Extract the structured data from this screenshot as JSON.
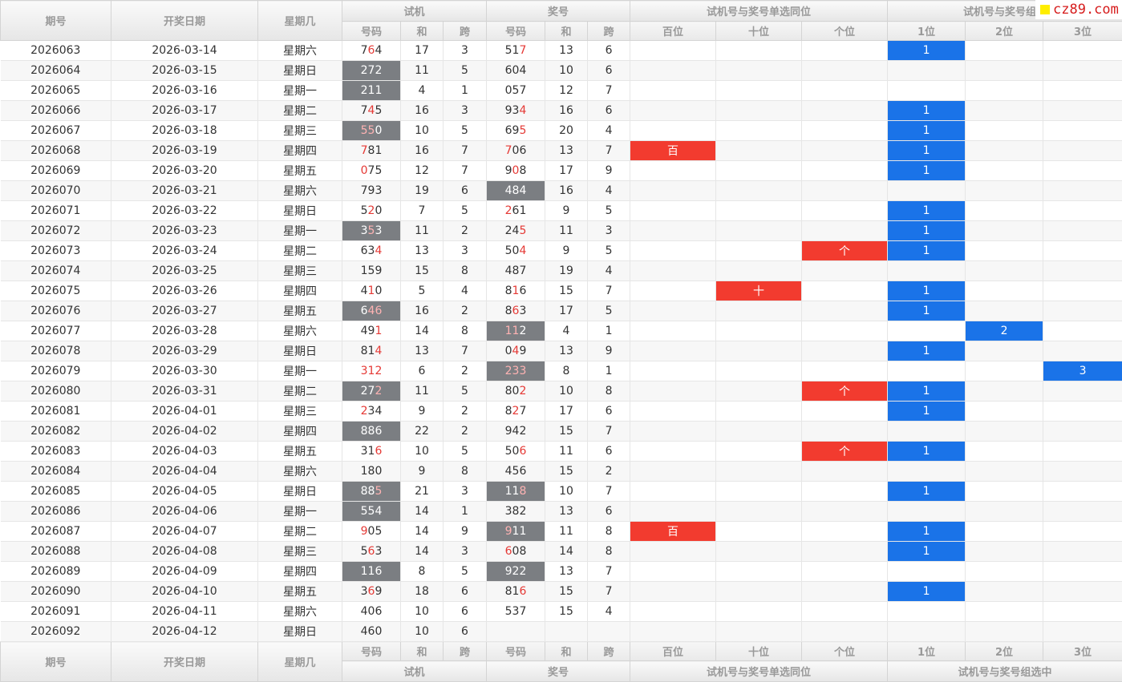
{
  "header": {
    "col_issue": "期号",
    "col_date": "开奖日期",
    "col_week": "星期几",
    "group_trial": "试机",
    "group_prize": "奖号",
    "group_same_pos": "试机号与奖号单选同位",
    "group_combo_top": "试机号与奖号组选",
    "group_combo_bottom": "试机号与奖号组选中",
    "sub_number": "号码",
    "sub_sum": "和",
    "sub_span": "跨",
    "sub_hundreds": "百位",
    "sub_tens": "十位",
    "sub_ones": "个位",
    "sub_1": "1位",
    "sub_2": "2位",
    "sub_3": "3位"
  },
  "watermark": {
    "text": "cz89.com"
  },
  "colors": {
    "gray_cell": "#7b7e82",
    "red_hit": "#f23b2f",
    "blue_hit": "#1a73e8",
    "red_digit": "#e53935"
  },
  "rows": [
    {
      "issue": "2026063",
      "date": "2026-03-14",
      "week": "星期六",
      "trial": "764",
      "trial_red": [
        1
      ],
      "trial_gray": false,
      "tsum": "17",
      "tspan": "3",
      "prize": "517",
      "prize_red": [
        2
      ],
      "prize_gray": false,
      "psum": "13",
      "pspan": "6",
      "pos": "",
      "combo": "1"
    },
    {
      "issue": "2026064",
      "date": "2026-03-15",
      "week": "星期日",
      "trial": "272",
      "trial_red": [],
      "trial_gray": true,
      "tsum": "11",
      "tspan": "5",
      "prize": "604",
      "prize_red": [],
      "prize_gray": false,
      "psum": "10",
      "pspan": "6",
      "pos": "",
      "combo": ""
    },
    {
      "issue": "2026065",
      "date": "2026-03-16",
      "week": "星期一",
      "trial": "211",
      "trial_red": [],
      "trial_gray": true,
      "tsum": "4",
      "tspan": "1",
      "prize": "057",
      "prize_red": [],
      "prize_gray": false,
      "psum": "12",
      "pspan": "7",
      "pos": "",
      "combo": ""
    },
    {
      "issue": "2026066",
      "date": "2026-03-17",
      "week": "星期二",
      "trial": "745",
      "trial_red": [
        1
      ],
      "trial_gray": false,
      "tsum": "16",
      "tspan": "3",
      "prize": "934",
      "prize_red": [
        2
      ],
      "prize_gray": false,
      "psum": "16",
      "pspan": "6",
      "pos": "",
      "combo": "1"
    },
    {
      "issue": "2026067",
      "date": "2026-03-18",
      "week": "星期三",
      "trial": "550",
      "trial_red": [
        0,
        1
      ],
      "trial_gray": true,
      "tsum": "10",
      "tspan": "5",
      "prize": "695",
      "prize_red": [
        2
      ],
      "prize_gray": false,
      "psum": "20",
      "pspan": "4",
      "pos": "",
      "combo": "1"
    },
    {
      "issue": "2026068",
      "date": "2026-03-19",
      "week": "星期四",
      "trial": "781",
      "trial_red": [
        0
      ],
      "trial_gray": false,
      "tsum": "16",
      "tspan": "7",
      "prize": "706",
      "prize_red": [
        0
      ],
      "prize_gray": false,
      "psum": "13",
      "pspan": "7",
      "pos": "百",
      "combo": "1"
    },
    {
      "issue": "2026069",
      "date": "2026-03-20",
      "week": "星期五",
      "trial": "075",
      "trial_red": [
        0
      ],
      "trial_gray": false,
      "tsum": "12",
      "tspan": "7",
      "prize": "908",
      "prize_red": [
        1
      ],
      "prize_gray": false,
      "psum": "17",
      "pspan": "9",
      "pos": "",
      "combo": "1"
    },
    {
      "issue": "2026070",
      "date": "2026-03-21",
      "week": "星期六",
      "trial": "793",
      "trial_red": [],
      "trial_gray": false,
      "tsum": "19",
      "tspan": "6",
      "prize": "484",
      "prize_red": [],
      "prize_gray": true,
      "psum": "16",
      "pspan": "4",
      "pos": "",
      "combo": ""
    },
    {
      "issue": "2026071",
      "date": "2026-03-22",
      "week": "星期日",
      "trial": "520",
      "trial_red": [
        1
      ],
      "trial_gray": false,
      "tsum": "7",
      "tspan": "5",
      "prize": "261",
      "prize_red": [
        0
      ],
      "prize_gray": false,
      "psum": "9",
      "pspan": "5",
      "pos": "",
      "combo": "1"
    },
    {
      "issue": "2026072",
      "date": "2026-03-23",
      "week": "星期一",
      "trial": "353",
      "trial_red": [
        1
      ],
      "trial_gray": true,
      "tsum": "11",
      "tspan": "2",
      "prize": "245",
      "prize_red": [
        2
      ],
      "prize_gray": false,
      "psum": "11",
      "pspan": "3",
      "pos": "",
      "combo": "1"
    },
    {
      "issue": "2026073",
      "date": "2026-03-24",
      "week": "星期二",
      "trial": "634",
      "trial_red": [
        2
      ],
      "trial_gray": false,
      "tsum": "13",
      "tspan": "3",
      "prize": "504",
      "prize_red": [
        2
      ],
      "prize_gray": false,
      "psum": "9",
      "pspan": "5",
      "pos": "个",
      "combo": "1"
    },
    {
      "issue": "2026074",
      "date": "2026-03-25",
      "week": "星期三",
      "trial": "159",
      "trial_red": [],
      "trial_gray": false,
      "tsum": "15",
      "tspan": "8",
      "prize": "487",
      "prize_red": [],
      "prize_gray": false,
      "psum": "19",
      "pspan": "4",
      "pos": "",
      "combo": ""
    },
    {
      "issue": "2026075",
      "date": "2026-03-26",
      "week": "星期四",
      "trial": "410",
      "trial_red": [
        1
      ],
      "trial_gray": false,
      "tsum": "5",
      "tspan": "4",
      "prize": "816",
      "prize_red": [
        1
      ],
      "prize_gray": false,
      "psum": "15",
      "pspan": "7",
      "pos": "十",
      "combo": "1"
    },
    {
      "issue": "2026076",
      "date": "2026-03-27",
      "week": "星期五",
      "trial": "646",
      "trial_red": [
        1,
        2
      ],
      "trial_gray": true,
      "tsum": "16",
      "tspan": "2",
      "prize": "863",
      "prize_red": [
        1
      ],
      "prize_gray": false,
      "psum": "17",
      "pspan": "5",
      "pos": "",
      "combo": "1"
    },
    {
      "issue": "2026077",
      "date": "2026-03-28",
      "week": "星期六",
      "trial": "491",
      "trial_red": [
        2
      ],
      "trial_gray": false,
      "tsum": "14",
      "tspan": "8",
      "prize": "112",
      "prize_red": [
        0,
        1
      ],
      "prize_gray": true,
      "psum": "4",
      "pspan": "1",
      "pos": "",
      "combo": "2"
    },
    {
      "issue": "2026078",
      "date": "2026-03-29",
      "week": "星期日",
      "trial": "814",
      "trial_red": [
        2
      ],
      "trial_gray": false,
      "tsum": "13",
      "tspan": "7",
      "prize": "049",
      "prize_red": [
        1
      ],
      "prize_gray": false,
      "psum": "13",
      "pspan": "9",
      "pos": "",
      "combo": "1"
    },
    {
      "issue": "2026079",
      "date": "2026-03-30",
      "week": "星期一",
      "trial": "312",
      "trial_red": [
        0,
        1,
        2
      ],
      "trial_gray": false,
      "tsum": "6",
      "tspan": "2",
      "prize": "233",
      "prize_red": [
        0,
        1,
        2
      ],
      "prize_gray": true,
      "psum": "8",
      "pspan": "1",
      "pos": "",
      "combo": "3"
    },
    {
      "issue": "2026080",
      "date": "2026-03-31",
      "week": "星期二",
      "trial": "272",
      "trial_red": [
        2
      ],
      "trial_gray": true,
      "tsum": "11",
      "tspan": "5",
      "prize": "802",
      "prize_red": [
        2
      ],
      "prize_gray": false,
      "psum": "10",
      "pspan": "8",
      "pos": "个",
      "combo": "1"
    },
    {
      "issue": "2026081",
      "date": "2026-04-01",
      "week": "星期三",
      "trial": "234",
      "trial_red": [
        0
      ],
      "trial_gray": false,
      "tsum": "9",
      "tspan": "2",
      "prize": "827",
      "prize_red": [
        1
      ],
      "prize_gray": false,
      "psum": "17",
      "pspan": "6",
      "pos": "",
      "combo": "1"
    },
    {
      "issue": "2026082",
      "date": "2026-04-02",
      "week": "星期四",
      "trial": "886",
      "trial_red": [],
      "trial_gray": true,
      "tsum": "22",
      "tspan": "2",
      "prize": "942",
      "prize_red": [],
      "prize_gray": false,
      "psum": "15",
      "pspan": "7",
      "pos": "",
      "combo": ""
    },
    {
      "issue": "2026083",
      "date": "2026-04-03",
      "week": "星期五",
      "trial": "316",
      "trial_red": [
        2
      ],
      "trial_gray": false,
      "tsum": "10",
      "tspan": "5",
      "prize": "506",
      "prize_red": [
        2
      ],
      "prize_gray": false,
      "psum": "11",
      "pspan": "6",
      "pos": "个",
      "combo": "1"
    },
    {
      "issue": "2026084",
      "date": "2026-04-04",
      "week": "星期六",
      "trial": "180",
      "trial_red": [],
      "trial_gray": false,
      "tsum": "9",
      "tspan": "8",
      "prize": "456",
      "prize_red": [],
      "prize_gray": false,
      "psum": "15",
      "pspan": "2",
      "pos": "",
      "combo": ""
    },
    {
      "issue": "2026085",
      "date": "2026-04-05",
      "week": "星期日",
      "trial": "885",
      "trial_red": [
        2
      ],
      "trial_gray": true,
      "tsum": "21",
      "tspan": "3",
      "prize": "118",
      "prize_red": [
        2
      ],
      "prize_gray": true,
      "psum": "10",
      "pspan": "7",
      "pos": "",
      "combo": "1"
    },
    {
      "issue": "2026086",
      "date": "2026-04-06",
      "week": "星期一",
      "trial": "554",
      "trial_red": [],
      "trial_gray": true,
      "tsum": "14",
      "tspan": "1",
      "prize": "382",
      "prize_red": [],
      "prize_gray": false,
      "psum": "13",
      "pspan": "6",
      "pos": "",
      "combo": ""
    },
    {
      "issue": "2026087",
      "date": "2026-04-07",
      "week": "星期二",
      "trial": "905",
      "trial_red": [
        0
      ],
      "trial_gray": false,
      "tsum": "14",
      "tspan": "9",
      "prize": "911",
      "prize_red": [
        0
      ],
      "prize_gray": true,
      "psum": "11",
      "pspan": "8",
      "pos": "百",
      "combo": "1"
    },
    {
      "issue": "2026088",
      "date": "2026-04-08",
      "week": "星期三",
      "trial": "563",
      "trial_red": [
        1
      ],
      "trial_gray": false,
      "tsum": "14",
      "tspan": "3",
      "prize": "608",
      "prize_red": [
        0
      ],
      "prize_gray": false,
      "psum": "14",
      "pspan": "8",
      "pos": "",
      "combo": "1"
    },
    {
      "issue": "2026089",
      "date": "2026-04-09",
      "week": "星期四",
      "trial": "116",
      "trial_red": [],
      "trial_gray": true,
      "tsum": "8",
      "tspan": "5",
      "prize": "922",
      "prize_red": [],
      "prize_gray": true,
      "psum": "13",
      "pspan": "7",
      "pos": "",
      "combo": ""
    },
    {
      "issue": "2026090",
      "date": "2026-04-10",
      "week": "星期五",
      "trial": "369",
      "trial_red": [
        1
      ],
      "trial_gray": false,
      "tsum": "18",
      "tspan": "6",
      "prize": "816",
      "prize_red": [
        2
      ],
      "prize_gray": false,
      "psum": "15",
      "pspan": "7",
      "pos": "",
      "combo": "1"
    },
    {
      "issue": "2026091",
      "date": "2026-04-11",
      "week": "星期六",
      "trial": "406",
      "trial_red": [],
      "trial_gray": false,
      "tsum": "10",
      "tspan": "6",
      "prize": "537",
      "prize_red": [],
      "prize_gray": false,
      "psum": "15",
      "pspan": "4",
      "pos": "",
      "combo": ""
    },
    {
      "issue": "2026092",
      "date": "2026-04-12",
      "week": "星期日",
      "trial": "460",
      "trial_red": [],
      "trial_gray": false,
      "tsum": "10",
      "tspan": "6",
      "prize": "",
      "prize_red": [],
      "prize_gray": false,
      "psum": "",
      "pspan": "",
      "pos": "",
      "combo": ""
    }
  ]
}
